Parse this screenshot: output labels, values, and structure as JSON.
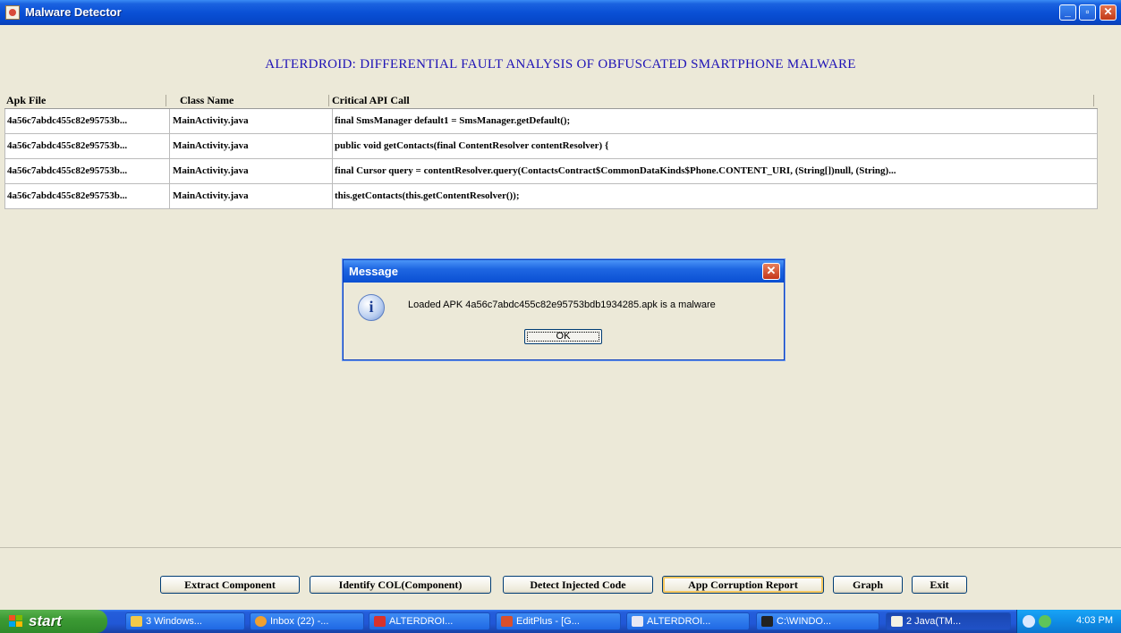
{
  "window": {
    "title": "Malware Detector"
  },
  "header": {
    "title": "ALTERDROID: DIFFERENTIAL FAULT ANALYSIS OF OBFUSCATED SMARTPHONE MALWARE"
  },
  "table": {
    "columns": [
      "Apk File",
      "Class Name",
      "Critical API Call"
    ],
    "rows": [
      [
        "4a56c7abdc455c82e95753b...",
        "MainActivity.java",
        "final SmsManager default1 = SmsManager.getDefault();"
      ],
      [
        "4a56c7abdc455c82e95753b...",
        "MainActivity.java",
        "public void getContacts(final ContentResolver contentResolver) {"
      ],
      [
        "4a56c7abdc455c82e95753b...",
        "MainActivity.java",
        "final Cursor query = contentResolver.query(ContactsContract$CommonDataKinds$Phone.CONTENT_URI, (String[])null, (String)..."
      ],
      [
        "4a56c7abdc455c82e95753b...",
        "MainActivity.java",
        "this.getContacts(this.getContentResolver());"
      ]
    ]
  },
  "dialog": {
    "title": "Message",
    "message": "Loaded APK 4a56c7abdc455c82e95753bdb1934285.apk is a malware",
    "ok_label": "OK",
    "icon": "info-icon"
  },
  "buttons": {
    "extract": "Extract Component",
    "identify": "Identify COL(Component)",
    "detect": "Detect Injected Code",
    "report": "App Corruption Report",
    "graph": "Graph",
    "exit": "Exit"
  },
  "taskbar": {
    "start": "start",
    "items": [
      "3 Windows...",
      "Inbox (22) -...",
      "ALTERDROI...",
      "EditPlus - [G...",
      "ALTERDROI...",
      "C:\\WINDO...",
      "2 Java(TM..."
    ],
    "clock": "4:03 PM"
  },
  "colors": {
    "title_text": "#1e12b6",
    "titlebar": "#0a50d6",
    "panel": "#ece9d8"
  }
}
